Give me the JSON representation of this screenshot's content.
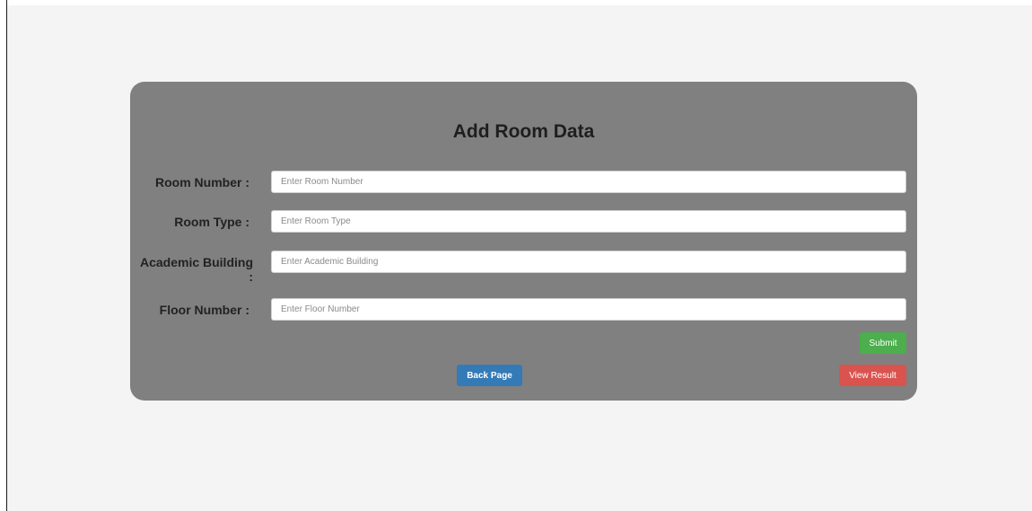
{
  "form": {
    "title": "Add Room Data",
    "fields": [
      {
        "label": "Room Number :",
        "placeholder": "Enter Room Number",
        "value": ""
      },
      {
        "label": "Room Type :",
        "placeholder": "Enter Room Type",
        "value": ""
      },
      {
        "label": "Academic Building :",
        "placeholder": "Enter Academic Building",
        "value": ""
      },
      {
        "label": "Floor Number :",
        "placeholder": "Enter Floor Number",
        "value": ""
      }
    ]
  },
  "buttons": {
    "submit_label": "Submit",
    "back_label": "Back Page",
    "view_label": "View Result"
  },
  "colors": {
    "panel": "#808080",
    "page_background": "#f4f4f4",
    "submit": "#4cae4c",
    "back": "#337ab7",
    "view_result": "#d9534f"
  }
}
